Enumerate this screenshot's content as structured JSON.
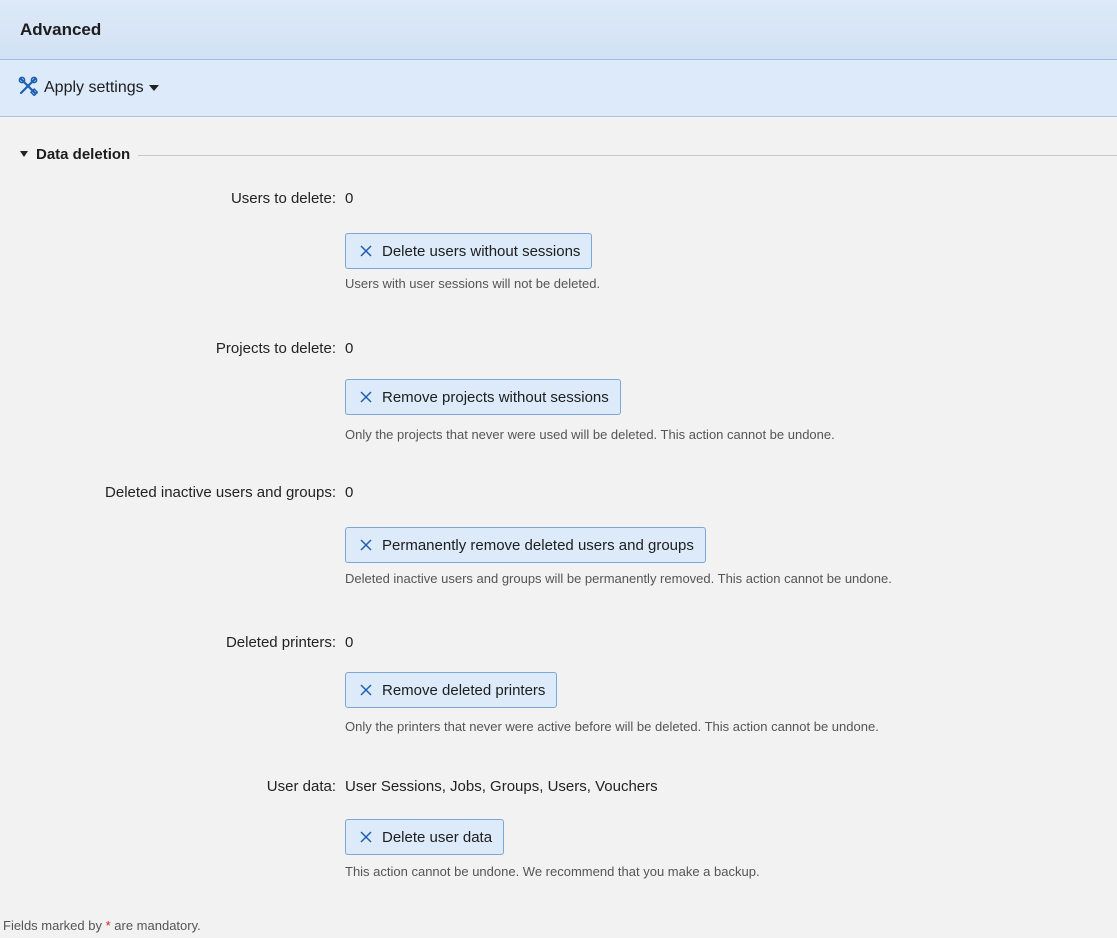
{
  "window": {
    "title": "Advanced"
  },
  "toolbar": {
    "apply_label": "Apply settings",
    "apply_icon": "tools-icon"
  },
  "section": {
    "title": "Data deletion",
    "expanded": true
  },
  "rows": [
    {
      "label": "Users to delete:",
      "value": "0",
      "button": "Delete users without sessions",
      "hint": "Users with user sessions will not be deleted."
    },
    {
      "label": "Projects to delete:",
      "value": "0",
      "button": "Remove projects without sessions",
      "hint": "Only the projects that never were used will be deleted. This action cannot be undone."
    },
    {
      "label": "Deleted inactive users and groups:",
      "value": "0",
      "button": "Permanently remove deleted users and groups",
      "hint": "Deleted inactive users and groups will be permanently removed. This action cannot be undone."
    },
    {
      "label": "Deleted printers:",
      "value": "0",
      "button": "Remove deleted printers",
      "hint": "Only the printers that never were active before will be deleted. This action cannot be undone."
    },
    {
      "label": "User data:",
      "value": "User Sessions, Jobs, Groups, Users, Vouchers",
      "button": "Delete user data",
      "hint": "This action cannot be undone. We recommend that you make a backup."
    }
  ],
  "footer": {
    "prefix": "Fields marked by ",
    "star": "*",
    "suffix": " are mandatory."
  },
  "colors": {
    "header_bg": "#d2e2f4",
    "toolbar_bg": "#dceaf9",
    "button_border": "#7ca6d8",
    "icon_blue": "#1f5fb0",
    "mandatory_star": "#d21f1f"
  }
}
